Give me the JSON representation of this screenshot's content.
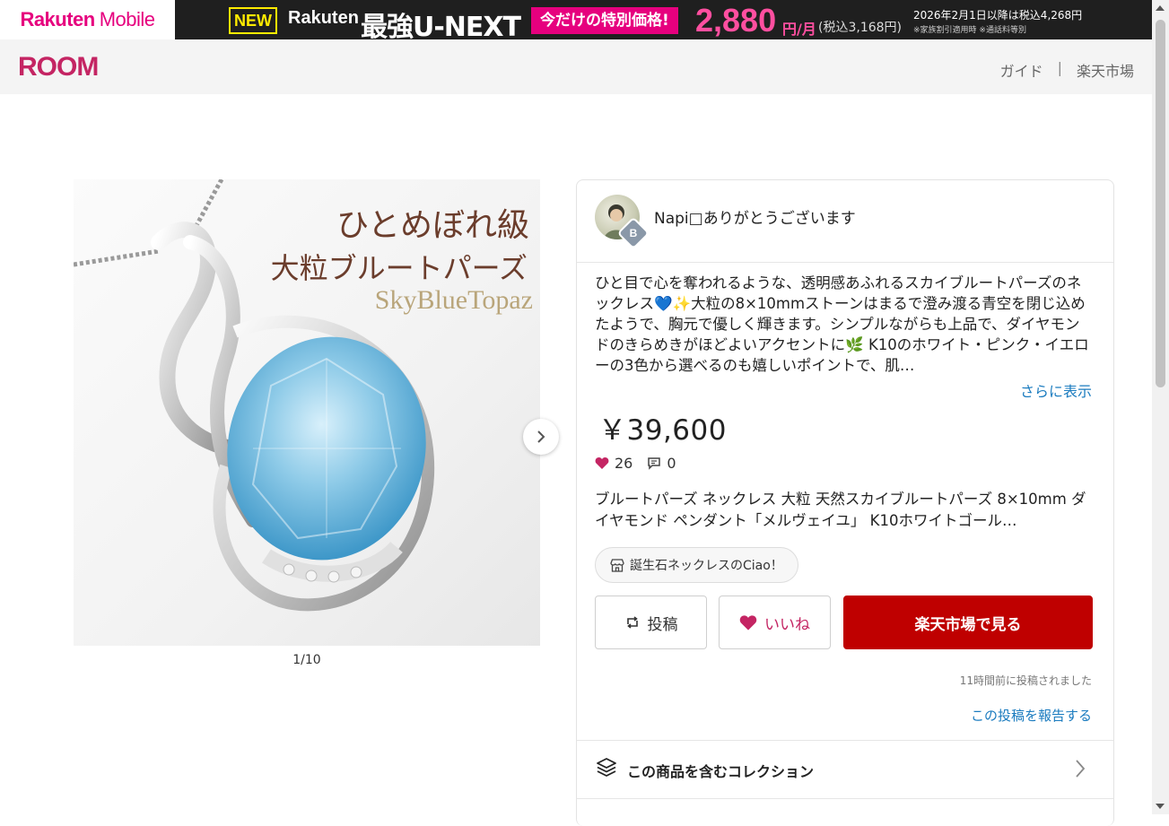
{
  "ad": {
    "brand": "Rakuten",
    "brand_sub": "Mobile",
    "new_badge": "NEW",
    "rakuten_text": "Rakuten",
    "product": "最強U-NEXT",
    "special": "今だけの特別価格!",
    "price": "2,880",
    "unit": "円/月",
    "tax": "(税込3,168円)",
    "note1": "2026年2月1日以降は税込4,268円",
    "note2": "※家族割引適用時 ※通話料等別"
  },
  "header": {
    "logo": "ROOM",
    "nav": [
      "ガイド",
      "楽天市場"
    ],
    "separator": "|"
  },
  "gallery": {
    "caption_line1": "ひとめぼれ級",
    "caption_line2": "大粒ブルートパーズ",
    "caption_line3": "SkyBlueTopaz",
    "counter": "1/10",
    "next_icon": "chevron-right-icon"
  },
  "post": {
    "user_name": "Napi□ありがとうございます",
    "user_badge": "B",
    "description": "ひと目で心を奪われるような、透明感あふれるスカイブルートパーズのネックレス💙✨大粒の8×10mmストーンはまるで澄み渡る青空を閉じ込めたようで、胸元で優しく輝きます。シンプルながらも上品で、ダイヤモンドのきらめきがほどよいアクセントに🌿 K10のホワイト・ピンク・イエローの3色から選べるのも嬉しいポイントで、肌…",
    "more_label": "さらに表示",
    "price": "￥39,600",
    "likes": "26",
    "comments": "0",
    "product_name": "ブルートパーズ ネックレス 大粒 天然スカイブルートパーズ 8×10mm ダイヤモンド ペンダント「メルヴェイユ」 K10ホワイトゴール…",
    "shop_name": "誕生石ネックレスのCiao！",
    "post_button": "投稿",
    "like_button": "いいね",
    "rakuten_button": "楽天市場で見る",
    "posted_time": "11時間前に投稿されました",
    "report_link": "この投稿を報告する",
    "collection_label": "この商品を含むコレクション"
  },
  "colors": {
    "brand": "#c42563",
    "rakuten_red": "#bf0000",
    "link": "#1a7bbf",
    "ad_pink": "#e6007e"
  }
}
